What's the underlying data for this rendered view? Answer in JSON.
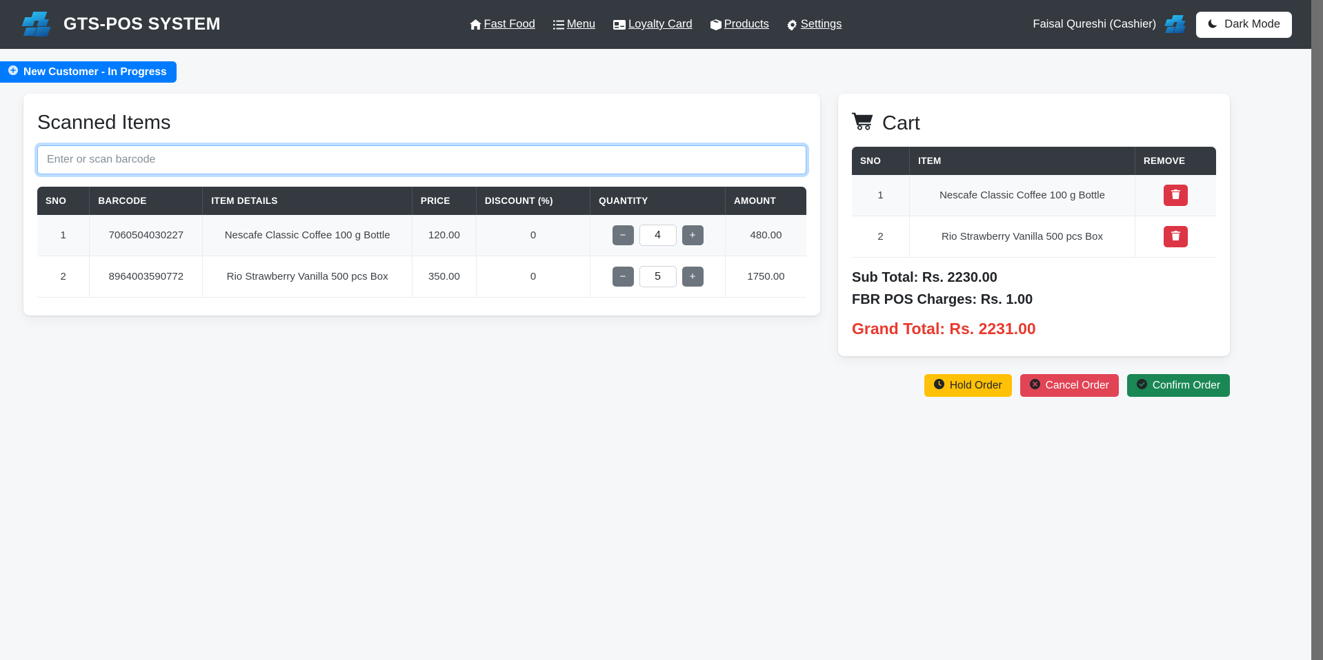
{
  "navbar": {
    "brand_title": "GTS-POS SYSTEM",
    "logo_icon": "gts-logo-icon",
    "links": [
      {
        "label": "Fast Food",
        "icon": "home-icon"
      },
      {
        "label": "Menu",
        "icon": "list-icon"
      },
      {
        "label": "Loyalty Card",
        "icon": "card-icon"
      },
      {
        "label": "Products",
        "icon": "box-icon"
      },
      {
        "label": "Settings",
        "icon": "gear-icon"
      }
    ],
    "user": "Faisal Qureshi (Cashier)",
    "dark_mode_label": "Dark Mode",
    "dark_mode_icon": "moon-icon"
  },
  "order_tab": {
    "label": "New Customer - In Progress",
    "icon": "plus-circle-icon",
    "color": "#007bff"
  },
  "scanned": {
    "title": "Scanned Items",
    "barcode_placeholder": "Enter or scan barcode",
    "barcode_value": "",
    "columns": [
      "SNO",
      "BARCODE",
      "ITEM DETAILS",
      "PRICE",
      "DISCOUNT (%)",
      "QUANTITY",
      "AMOUNT"
    ],
    "rows": [
      {
        "sno": "1",
        "barcode": "7060504030227",
        "item": "Nescafe Classic Coffee 100 g Bottle",
        "price": "120.00",
        "discount": "0",
        "qty": "4",
        "amount": "480.00",
        "minus": "−",
        "plus": "+"
      },
      {
        "sno": "2",
        "barcode": "8964003590772",
        "item": "Rio Strawberry Vanilla 500 pcs Box",
        "price": "350.00",
        "discount": "0",
        "qty": "5",
        "amount": "1750.00",
        "minus": "−",
        "plus": "+"
      }
    ]
  },
  "cart": {
    "title": "Cart",
    "icon": "shopping-cart-icon",
    "columns": [
      "SNO",
      "ITEM",
      "REMOVE"
    ],
    "rows": [
      {
        "sno": "1",
        "item": "Nescafe Classic Coffee 100 g Bottle",
        "remove_icon": "trash-icon"
      },
      {
        "sno": "2",
        "item": "Rio Strawberry Vanilla 500 pcs Box",
        "remove_icon": "trash-icon"
      }
    ],
    "sub_total": "Sub Total: Rs. 2230.00",
    "fbr_charges": "FBR POS Charges: Rs. 1.00",
    "grand_total": "Grand Total: Rs. 2231.00",
    "grand_total_color": "#e8392d"
  },
  "actions": [
    {
      "label": "Hold Order",
      "icon": "clock-icon",
      "color": "#ffc107"
    },
    {
      "label": "Cancel Order",
      "icon": "x-circle-icon",
      "color": "#e14455"
    },
    {
      "label": "Confirm Order",
      "icon": "check-circle-icon",
      "color": "#1a8754"
    }
  ]
}
